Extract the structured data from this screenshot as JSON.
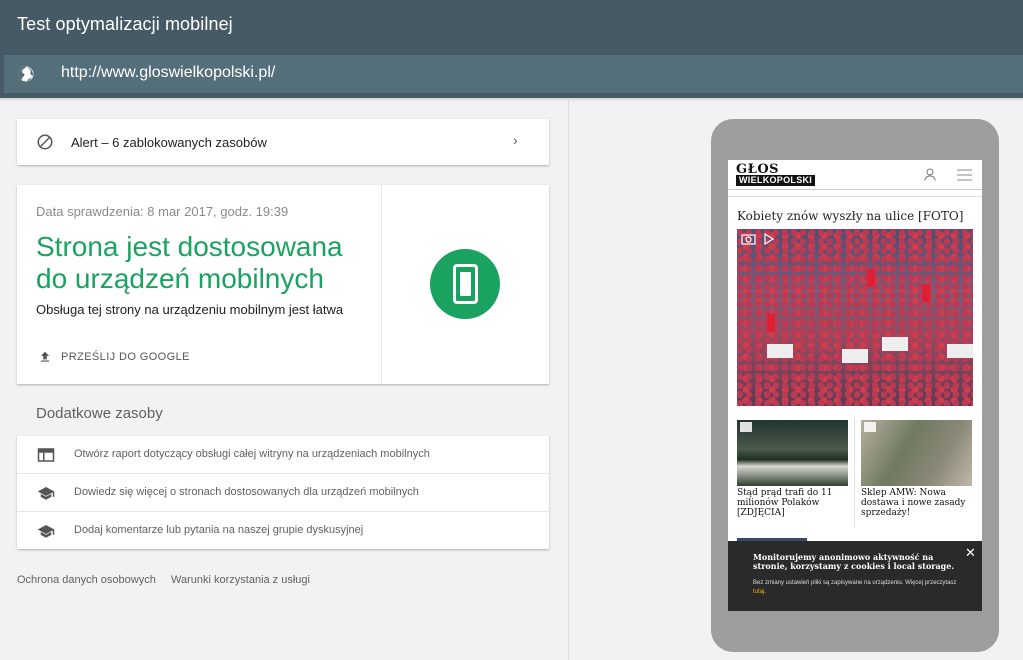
{
  "app": {
    "title": "Test optymalizacji mobilnej"
  },
  "urlbar": {
    "icon": "globe-icon",
    "url": "http://www.gloswielkopolski.pl/"
  },
  "alert": {
    "icon": "blocked-icon",
    "text": "Alert – 6 zablokowanych zasobów",
    "chevron": "›"
  },
  "result": {
    "date": "Data sprawdzenia: 8 mar 2017, godz. 19:39",
    "heading": "Strona jest dostosowana do urządzeń mobilnych",
    "subtitle": "Obsługa tej strony na urządzeniu mobilnym jest łatwa",
    "submit_label": "PRZEŚLIJ DO GOOGLE",
    "status_color": "#1aa260"
  },
  "resources": {
    "title": "Dodatkowe zasoby",
    "items": [
      {
        "icon": "report-icon",
        "text": "Otwórz raport dotyczący obsługi całej witryny na urządzeniach mobilnych"
      },
      {
        "icon": "school-icon",
        "text": "Dowiedz się więcej o stronach dostosowanych dla urządzeń mobilnych"
      },
      {
        "icon": "school-icon",
        "text": "Dodaj komentarze lub pytania na naszej grupie dyskusyjnej"
      }
    ]
  },
  "footer": {
    "privacy": "Ochrona danych osobowych",
    "terms": "Warunki korzystania z usługi"
  },
  "preview": {
    "logo_top": "GŁOS",
    "logo_bottom": "WIELKOPOLSKI",
    "article_title": "Kobiety znów wyszły na ulice [FOTO]",
    "thumbs": [
      {
        "caption": "Stąd prąd trafi do 11 milionów Polaków [ZDJĘCIA]"
      },
      {
        "caption": "Sklep AMW: Nowa dostawa i nowe zasady sprzedaży!"
      }
    ],
    "cookie": {
      "title": "Monitorujemy anonimowo aktywność na stronie, korzystamy z cookies i local storage.",
      "body": "Bez zmiany ustawień pliki są zapisywane na urządzeniu. Więcej przeczytasz ",
      "link": "tutaj",
      "close": "✕"
    }
  }
}
